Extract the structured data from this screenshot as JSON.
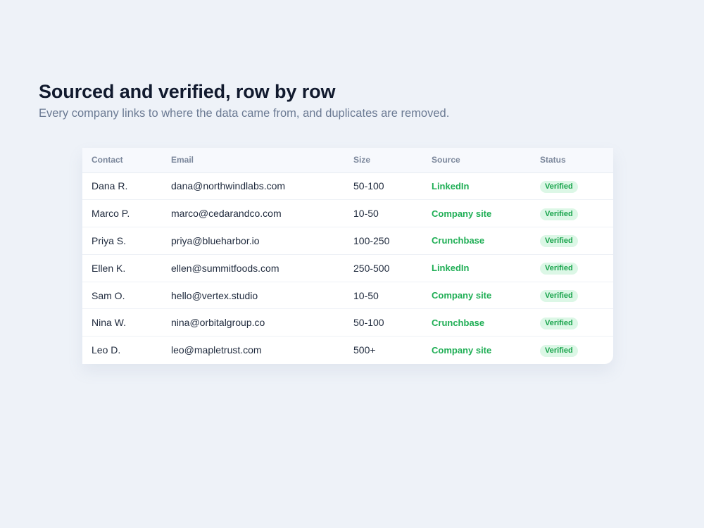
{
  "header": {
    "title": "Sourced and verified, row by row",
    "subtitle": "Every company links to where the data came from, and duplicates are removed."
  },
  "table": {
    "columns": [
      "Contact",
      "Email",
      "Size",
      "Source",
      "Status"
    ],
    "rows": [
      {
        "contact": "Dana R.",
        "email": "dana@northwindlabs.com",
        "size": "50-100",
        "source": "LinkedIn",
        "status": "Verified"
      },
      {
        "contact": "Marco P.",
        "email": "marco@cedarandco.com",
        "size": "10-50",
        "source": "Company site",
        "status": "Verified"
      },
      {
        "contact": "Priya S.",
        "email": "priya@blueharbor.io",
        "size": "100-250",
        "source": "Crunchbase",
        "status": "Verified"
      },
      {
        "contact": "Ellen K.",
        "email": "ellen@summitfoods.com",
        "size": "250-500",
        "source": "LinkedIn",
        "status": "Verified"
      },
      {
        "contact": "Sam O.",
        "email": "hello@vertex.studio",
        "size": "10-50",
        "source": "Company site",
        "status": "Verified"
      },
      {
        "contact": "Nina W.",
        "email": "nina@orbitalgroup.co",
        "size": "50-100",
        "source": "Crunchbase",
        "status": "Verified"
      },
      {
        "contact": "Leo D.",
        "email": "leo@mapletrust.com",
        "size": "500+",
        "source": "Company site",
        "status": "Verified"
      }
    ]
  },
  "colors": {
    "background": "#eef2f8",
    "title": "#111a2e",
    "subtitle": "#6b7a93",
    "source_link": "#1fae55",
    "verified_badge_bg": "#dcf7e6",
    "verified_badge_text": "#17a34a"
  }
}
